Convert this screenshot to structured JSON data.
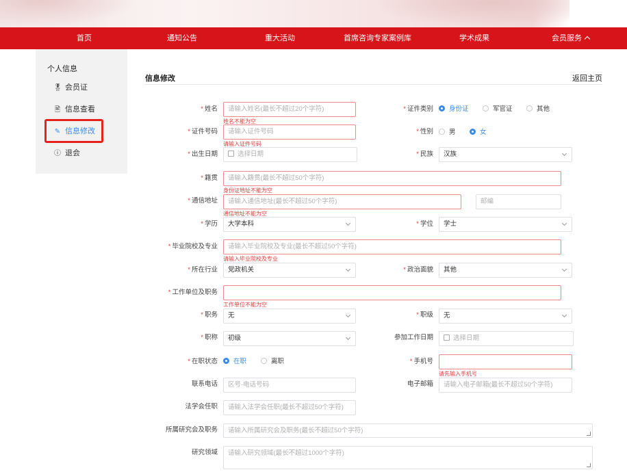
{
  "nav": {
    "home": "首页",
    "notice": "通知公告",
    "events": "重大活动",
    "cases": "首席咨询专家案例库",
    "research": "学术成果",
    "member": "会员服务"
  },
  "sidebar": {
    "title": "个人信息",
    "items": [
      {
        "label": "会员证",
        "icon": "badge-icon"
      },
      {
        "label": "信息查看",
        "icon": "document-icon"
      },
      {
        "label": "信息修改",
        "icon": "edit-icon"
      },
      {
        "label": "退会",
        "icon": "info-circle-icon"
      }
    ]
  },
  "form": {
    "title": "信息修改",
    "back": "返回主页",
    "required_mark": "*",
    "name": {
      "label": "姓名",
      "placeholder": "请输入姓名(最长不超过20个字符)",
      "error": "姓名不能为空"
    },
    "id_type": {
      "label": "证件类别",
      "options": [
        "身份证",
        "军官证",
        "其他"
      ],
      "selected": "身份证"
    },
    "id_number": {
      "label": "证件号码",
      "placeholder": "请输入证件号码",
      "error": "请输入证件号码"
    },
    "gender": {
      "label": "性别",
      "options": [
        "男",
        "女"
      ],
      "selected": "女"
    },
    "birth": {
      "label": "出生日期",
      "placeholder": "选择日期"
    },
    "ethnicity": {
      "label": "民族",
      "value": "汉族"
    },
    "native_place": {
      "label": "籍贯",
      "placeholder": "请输入籍贯(最长不超过50个字符)",
      "error": "身份证地址不能为空"
    },
    "address": {
      "label": "通信地址",
      "placeholder": "请输入通信地址(最长不超过50个字符)",
      "error": "通信地址不能为空",
      "postcode_placeholder": "邮编"
    },
    "education": {
      "label": "学历",
      "value": "大学本科"
    },
    "degree": {
      "label": "学位",
      "value": "学士"
    },
    "school": {
      "label": "毕业院校及专业",
      "placeholder": "请输入毕业院校及专业(最长不超过50个字符)",
      "error": "请输入毕业院校及专业"
    },
    "industry": {
      "label": "所在行业",
      "value": "党政机关"
    },
    "politics": {
      "label": "政治面貌",
      "value": "其他"
    },
    "employer": {
      "label": "工作单位及职务",
      "placeholder": "",
      "error": "工作单位不能为空"
    },
    "position": {
      "label": "职务",
      "value": "无"
    },
    "rank": {
      "label": "职级",
      "value": "无"
    },
    "title_rank": {
      "label": "职称",
      "value": "初级"
    },
    "work_start": {
      "label": "参加工作日期",
      "placeholder": "选择日期"
    },
    "employment": {
      "label": "在职状态",
      "options": [
        "在职",
        "离职"
      ],
      "selected": "在职"
    },
    "mobile": {
      "label": "手机号",
      "placeholder": "",
      "error": "请先输入手机号"
    },
    "phone": {
      "label": "联系电话",
      "placeholder": "区号-电话号码"
    },
    "email": {
      "label": "电子邮箱",
      "placeholder": "请输入电子邮箱(最长不超过50个字符)"
    },
    "law_society": {
      "label": "法学会任职",
      "placeholder": "请输入法学会任职(最长不超过50个字符)"
    },
    "research_society": {
      "label": "所属研究会及职务",
      "placeholder": "请输入所属研究会及职务(最长不超过50个字符)"
    },
    "research_field": {
      "label": "研究领域",
      "placeholder": "请输入研究领域(最长不超过1000个字符)"
    }
  },
  "colors": {
    "nav_red": "#d8141b",
    "accent_blue": "#3a8be8",
    "error_red": "#e23c3c",
    "highlight_box": "#e5231b"
  }
}
